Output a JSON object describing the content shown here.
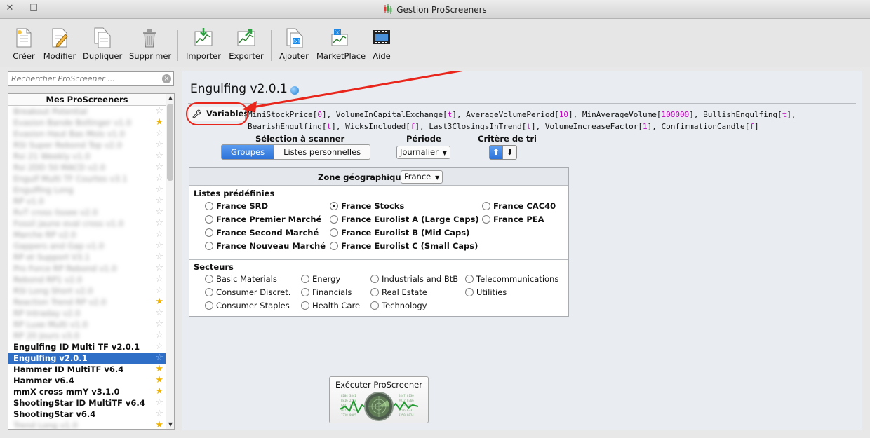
{
  "window": {
    "title": "Gestion ProScreeners"
  },
  "toolbar": {
    "buttons": [
      "Créer",
      "Modifier",
      "Dupliquer",
      "Supprimer",
      "Importer",
      "Exporter",
      "Ajouter",
      "MarketPlace",
      "Aide"
    ]
  },
  "sidebar": {
    "search_placeholder": "Rechercher ProScreener ...",
    "list_header": "Mes ProScreeners",
    "items": [
      {
        "label": "Breakout Potential",
        "blurred": true,
        "starred": false
      },
      {
        "label": "Evasion Bande Bollinger v1.0",
        "blurred": true,
        "starred": true
      },
      {
        "label": "Evasion Haut Bas Mois v1.0",
        "blurred": true,
        "starred": false
      },
      {
        "label": "RSI Super Rebond Top v2.0",
        "blurred": true,
        "starred": false
      },
      {
        "label": "Rsi 21 Weekly v1.0",
        "blurred": true,
        "starred": false
      },
      {
        "label": "Rsi 2DD 50 MACD v2.0",
        "blurred": true,
        "starred": false
      },
      {
        "label": "Engulf Multi TF Courtes v3.1",
        "blurred": true,
        "starred": false
      },
      {
        "label": "Engulfing Long",
        "blurred": true,
        "starred": false
      },
      {
        "label": "RP v1.0",
        "blurred": true,
        "starred": false
      },
      {
        "label": "RvT cross lissee v2.0",
        "blurred": true,
        "starred": false
      },
      {
        "label": "Fossil jaune eval cross v1.0",
        "blurred": true,
        "starred": false
      },
      {
        "label": "Marche RP v2.0",
        "blurred": true,
        "starred": false
      },
      {
        "label": "Gappers and Gap v1.0",
        "blurred": true,
        "starred": false
      },
      {
        "label": "RP et Support V3.1",
        "blurred": true,
        "starred": false
      },
      {
        "label": "Pro Force RP Rebond v1.0",
        "blurred": true,
        "starred": false
      },
      {
        "label": "Rebond RP1 v2.0",
        "blurred": true,
        "starred": false
      },
      {
        "label": "RSI Long Short v2.0",
        "blurred": true,
        "starred": false
      },
      {
        "label": "Reaction Trend RP v2.0",
        "blurred": true,
        "starred": true
      },
      {
        "label": "RP Intraday v2.0",
        "blurred": true,
        "starred": false
      },
      {
        "label": "RP Luxe Multi v1.0",
        "blurred": true,
        "starred": false
      },
      {
        "label": "RP 20 Jours v3.0",
        "blurred": true,
        "starred": false
      },
      {
        "label": "Engulfing ID Multi TF v2.0.1",
        "blurred": false,
        "starred": false
      },
      {
        "label": "Engulfing v2.0.1",
        "blurred": false,
        "starred": false,
        "selected": true
      },
      {
        "label": "Hammer ID MultiTF v6.4",
        "blurred": false,
        "starred": true
      },
      {
        "label": "Hammer v6.4",
        "blurred": false,
        "starred": true
      },
      {
        "label": "mmX cross mmY v3.1.0",
        "blurred": false,
        "starred": true
      },
      {
        "label": "ShootingStar ID MultiTF v6.4",
        "blurred": false,
        "starred": false
      },
      {
        "label": "ShootingStar v6.4",
        "blurred": false,
        "starred": false
      },
      {
        "label": "Trend Long v1.0",
        "blurred": true,
        "starred": true
      }
    ]
  },
  "main": {
    "title": "Engulfing v2.0.1",
    "variables_button": "Variables",
    "variables": [
      {
        "name": "MiniStockPrice",
        "value": "0"
      },
      {
        "name": "VolumeInCapitalExchange",
        "value": "t"
      },
      {
        "name": "AverageVolumePeriod",
        "value": "10"
      },
      {
        "name": "MinAverageVolume",
        "value": "100000"
      },
      {
        "name": "BullishEngulfing",
        "value": "t"
      },
      {
        "name": "BearishEngulfing",
        "value": "t"
      },
      {
        "name": "WicksIncluded",
        "value": "f"
      },
      {
        "name": "Last3ClosingsInTrend",
        "value": "t"
      },
      {
        "name": "VolumeIncreaseFactor",
        "value": "1"
      },
      {
        "name": "ConfirmationCandle",
        "value": "f"
      }
    ],
    "selection_label": "Sélection à scanner",
    "selection_tabs": [
      "Groupes",
      "Listes personnelles"
    ],
    "period_label": "Période",
    "period_value": "Journalier",
    "sort_label": "Critère de tri",
    "geo_label": "Zone géographique :",
    "geo_value": "France",
    "predef_title": "Listes prédéfinies",
    "predef": [
      "France SRD",
      "France Premier Marché",
      "France Second Marché",
      "France Nouveau Marché",
      "France Stocks",
      "France Eurolist A (Large Caps)",
      "France Eurolist B (Mid Caps)",
      "France Eurolist C (Small Caps)",
      "France CAC40",
      "France PEA"
    ],
    "predef_selected": "France Stocks",
    "sectors_title": "Secteurs",
    "sectors": [
      "Basic Materials",
      "Consumer Discret.",
      "Consumer Staples",
      "Energy",
      "Financials",
      "Health Care",
      "Industrials and BtB",
      "Real Estate",
      "Technology",
      "Telecommunications",
      "Utilities"
    ],
    "execute_label": "Exécuter ProScreener"
  }
}
